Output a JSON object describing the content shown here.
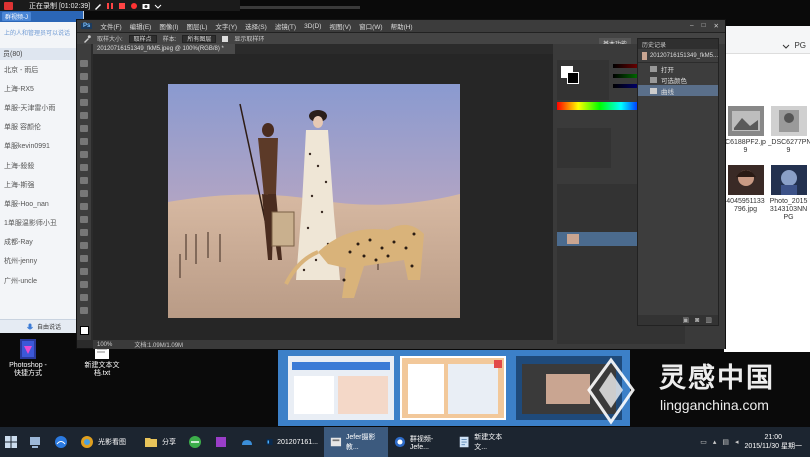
{
  "recorder": {
    "status": "正在录制 [01:02:39]"
  },
  "chat": {
    "tab": "群视频-J",
    "notice": "上的人和管理员可以说话",
    "count": "员(80)",
    "members": [
      "北京 - 雨后",
      "上海-RX5",
      "单服-天津雷小雨",
      "单服 容颜伦",
      "单服kevin0991",
      "上海-殺殺",
      "上海-斯强",
      "单服-Hoo_nan",
      "1单服温影师小丑",
      "成都-Ray",
      "杭州-jenny",
      "广州-uncle"
    ],
    "footer": "自由说话"
  },
  "desktop": {
    "icons": [
      {
        "label": "Photoshop -\n快捷方式"
      },
      {
        "label": "新建文本文\n档.txt"
      }
    ]
  },
  "photoshop": {
    "menu": [
      "文件(F)",
      "编辑(E)",
      "图像(I)",
      "图层(L)",
      "文字(Y)",
      "选择(S)",
      "滤镜(T)",
      "3D(D)",
      "视图(V)",
      "窗口(W)",
      "帮助(H)"
    ],
    "options": {
      "size_label": "取样大小:",
      "size_value": "取样点",
      "sample_label": "样本:",
      "sample_value": "所有图层",
      "ring": "显示取样环"
    },
    "workspace": "基本功能",
    "document_tab": "20120716151349_fkM5.jpeg @ 100%(RGB/8) *",
    "zoom": "100%",
    "doc_info": "文档:1.09M/1.09M"
  },
  "history": {
    "header": "历史记录",
    "snapshot": "20120716151349_fkM5...",
    "rows": [
      "打开",
      "可选颜色",
      "曲线"
    ],
    "active_row": 2
  },
  "explorer": {
    "view": "PG",
    "files": [
      {
        "label": "C6188PF2.jp\n9"
      },
      {
        "label": "_DSC6277PN\n9"
      },
      {
        "label": "4045951133\n796.jpg"
      },
      {
        "label": "Photo_2015\n3143103NN\nPG"
      }
    ]
  },
  "taskbar": {
    "items": [
      {
        "label": "光影看图"
      },
      {
        "label": "分享"
      },
      {
        "label": "201207161..."
      },
      {
        "label": "Jefer摄影教..."
      },
      {
        "label": "群视频-Jefe..."
      },
      {
        "label": "新建文本文..."
      }
    ],
    "active_index": 3,
    "time": "21:00",
    "date": "2015/11/30 星期一"
  },
  "watermark": {
    "title": "灵感中国",
    "url": "lingganchina.com"
  }
}
